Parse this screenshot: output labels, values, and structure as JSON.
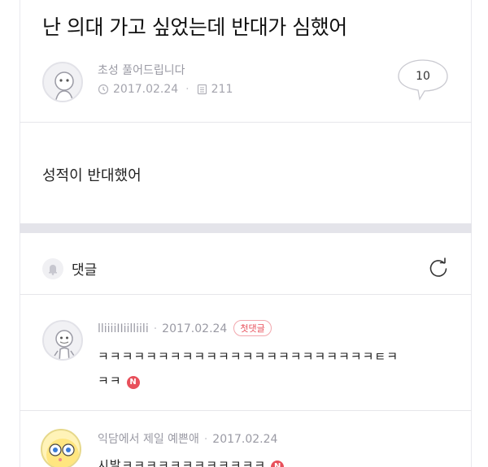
{
  "post": {
    "title": "난 의대 가고 싶었는데 반대가 심했어",
    "author": "초성 풀어드립니다",
    "date": "2017.02.24",
    "views": "211",
    "comment_count": "10",
    "content": "성적이 반대했어"
  },
  "comments_section": {
    "label": "댓글"
  },
  "comments": [
    {
      "author": "lliiiiIIiilliili",
      "date": "2017.02.24",
      "badge": "첫댓글",
      "line1": "ㅋㅋㅋㅋㅋㅋㅋㅋㅋㅋㅋㅋㅋㅋㅋㅋㅋㅋㅋㅋㅋㅋㅋㅌㅋ",
      "line2": "ㅋㅋ",
      "new_mark": "N"
    },
    {
      "author": "익담에서 제일 예쁜애",
      "date": "2017.02.24",
      "line1": "시발ㅋㅋㅋㅋㅋㅋㅋㅋㅋㅋㅋㅋ",
      "new_mark": "N"
    }
  ],
  "colors": {
    "accent": "#e8505b",
    "muted_text": "#9a9aa4",
    "band": "#e4e4ea"
  },
  "icons": {
    "clock": "clock-icon",
    "views": "document-icon",
    "comment": "speech-bubble-icon",
    "refresh": "refresh-icon",
    "bell": "bell-icon"
  }
}
